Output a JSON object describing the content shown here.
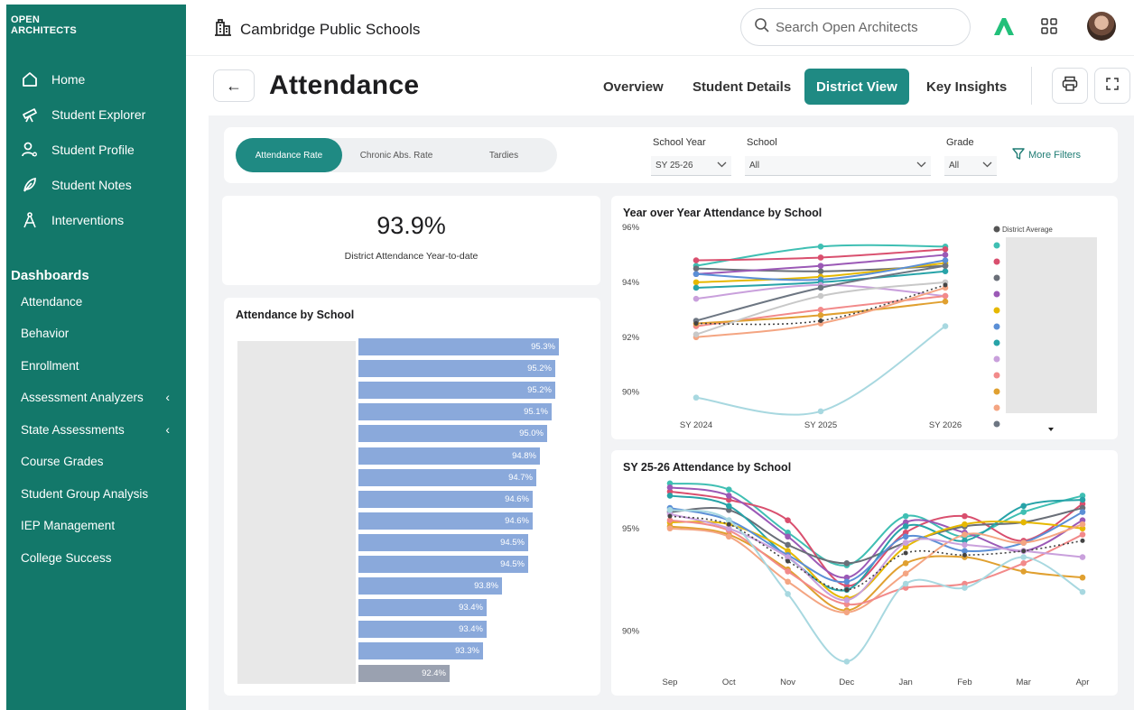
{
  "brand": {
    "line1": "OPEN",
    "line2": "ARCHITECTS"
  },
  "nav": [
    {
      "label": "Home",
      "icon": "home-icon"
    },
    {
      "label": "Student Explorer",
      "icon": "telescope-icon"
    },
    {
      "label": "Student Profile",
      "icon": "profile-icon"
    },
    {
      "label": "Student Notes",
      "icon": "feather-icon"
    },
    {
      "label": "Interventions",
      "icon": "compass-icon"
    }
  ],
  "dashboards": {
    "title": "Dashboards",
    "items": [
      {
        "label": "Attendance",
        "chevron": ""
      },
      {
        "label": "Behavior",
        "chevron": ""
      },
      {
        "label": "Enrollment",
        "chevron": ""
      },
      {
        "label": "Assessment Analyzers",
        "chevron": "‹"
      },
      {
        "label": "State Assessments",
        "chevron": "‹"
      },
      {
        "label": "Course Grades",
        "chevron": ""
      },
      {
        "label": "Student Group Analysis",
        "chevron": ""
      },
      {
        "label": "IEP Management",
        "chevron": ""
      },
      {
        "label": "College Success",
        "chevron": ""
      }
    ]
  },
  "topbar": {
    "org": "Cambridge Public Schools",
    "search_placeholder": "Search Open Architects"
  },
  "header": {
    "title": "Attendance",
    "back": "←",
    "tabs": [
      {
        "label": "Overview",
        "active": false
      },
      {
        "label": "Student Details",
        "active": false
      },
      {
        "label": "District View",
        "active": true
      },
      {
        "label": "Key Insights",
        "active": false
      }
    ]
  },
  "filters": {
    "metrics": [
      "Attendance Rate",
      "Chronic Abs. Rate",
      "Tardies"
    ],
    "school_year": {
      "label": "School Year",
      "value": "SY 25-26"
    },
    "school": {
      "label": "School",
      "value": "All"
    },
    "grade": {
      "label": "Grade",
      "value": "All"
    },
    "more": "More Filters"
  },
  "kpi": {
    "value": "93.9%",
    "label": "District Attendance Year-to-date"
  },
  "colors": {
    "accent": "#1f8a83",
    "sidebar": "#13786a",
    "bar": "#8aa9db",
    "bar_avg": "#9aa1b0"
  },
  "chart_data": [
    {
      "type": "bar",
      "title": "Attendance by School",
      "orientation": "horizontal",
      "values": [
        95.3,
        95.2,
        95.2,
        95.1,
        95.0,
        94.8,
        94.7,
        94.6,
        94.6,
        94.5,
        94.5,
        93.8,
        93.4,
        93.4,
        93.3,
        92.4
      ],
      "labels": [
        "95.3%",
        "95.2%",
        "95.2%",
        "95.1%",
        "95.0%",
        "94.8%",
        "94.7%",
        "94.6%",
        "94.6%",
        "94.5%",
        "94.5%",
        "93.8%",
        "93.4%",
        "93.4%",
        "93.3%",
        "92.4%"
      ],
      "highlight_last": true
    },
    {
      "type": "line",
      "title": "Year over Year Attendance by School",
      "x": [
        "SY 2024",
        "SY 2025",
        "SY 2026"
      ],
      "y_ticks": [
        "96%",
        "94%",
        "92%",
        "90%"
      ],
      "ylim": [
        89.2,
        96
      ],
      "legend_first": "District Average",
      "series": [
        {
          "color": "#3fbfb3",
          "values": [
            94.6,
            95.3,
            95.3
          ]
        },
        {
          "color": "#d94f6e",
          "values": [
            94.8,
            94.9,
            95.2
          ]
        },
        {
          "color": "#6a6f78",
          "values": [
            94.5,
            94.4,
            94.6
          ]
        },
        {
          "color": "#9b59b6",
          "values": [
            94.3,
            94.6,
            95.0
          ]
        },
        {
          "color": "#e6b800",
          "values": [
            94.0,
            94.2,
            94.7
          ]
        },
        {
          "color": "#5b8fd6",
          "values": [
            94.3,
            94.1,
            94.8
          ]
        },
        {
          "color": "#27a3a8",
          "values": [
            93.8,
            94.0,
            94.4
          ]
        },
        {
          "color": "#c9a0dc",
          "values": [
            93.4,
            93.9,
            93.5
          ]
        },
        {
          "color": "#f28a8a",
          "values": [
            92.4,
            93.0,
            93.5
          ]
        },
        {
          "color": "#e0a030",
          "values": [
            92.5,
            92.8,
            93.3
          ]
        },
        {
          "color": "#f4a582",
          "values": [
            92.0,
            92.5,
            93.8
          ]
        },
        {
          "color": "#6d7682",
          "values": [
            92.6,
            93.8,
            94.6
          ]
        },
        {
          "color": "#c8c8c8",
          "values": [
            92.1,
            93.5,
            94.0
          ]
        },
        {
          "color": "#a8d8e0",
          "values": [
            89.8,
            89.3,
            92.4
          ]
        },
        {
          "color": "#444444",
          "values": [
            92.5,
            92.6,
            93.9
          ],
          "dashed": true
        }
      ]
    },
    {
      "type": "line",
      "title": "SY 25-26 Attendance by School",
      "x": [
        "Sep",
        "Oct",
        "Nov",
        "Dec",
        "Jan",
        "Feb",
        "Mar",
        "Apr"
      ],
      "y_ticks": [
        "95%",
        "90%"
      ],
      "ylim": [
        87.5,
        97.5
      ],
      "series": [
        {
          "color": "#3fbfb3",
          "values": [
            97.2,
            96.9,
            94.8,
            93.2,
            95.6,
            94.6,
            95.8,
            96.6
          ]
        },
        {
          "color": "#d94f6e",
          "values": [
            96.8,
            96.4,
            95.4,
            92.2,
            94.8,
            95.6,
            94.4,
            96.2
          ]
        },
        {
          "color": "#9b59b6",
          "values": [
            97.0,
            96.6,
            94.6,
            92.6,
            95.3,
            94.8,
            93.9,
            95.4
          ]
        },
        {
          "color": "#6a6f78",
          "values": [
            95.8,
            95.9,
            94.2,
            93.3,
            94.3,
            95.1,
            95.3,
            96.0
          ]
        },
        {
          "color": "#27a3a8",
          "values": [
            96.6,
            96.1,
            93.6,
            92.0,
            95.1,
            94.4,
            96.1,
            96.4
          ]
        },
        {
          "color": "#e6b800",
          "values": [
            95.3,
            95.2,
            93.9,
            91.6,
            94.1,
            95.2,
            95.3,
            95.0
          ]
        },
        {
          "color": "#5b8fd6",
          "values": [
            96.0,
            95.4,
            93.7,
            92.4,
            94.6,
            93.9,
            94.3,
            95.8
          ]
        },
        {
          "color": "#e0a030",
          "values": [
            95.1,
            94.7,
            93.0,
            91.0,
            93.3,
            93.6,
            92.9,
            92.6
          ]
        },
        {
          "color": "#f4a582",
          "values": [
            95.0,
            94.6,
            92.4,
            90.9,
            92.8,
            94.7,
            94.3,
            95.2
          ]
        },
        {
          "color": "#f28a8a",
          "values": [
            95.4,
            94.9,
            92.9,
            91.3,
            92.1,
            92.3,
            93.3,
            94.7
          ]
        },
        {
          "color": "#c9a0dc",
          "values": [
            95.7,
            95.0,
            93.6,
            91.5,
            94.3,
            94.2,
            93.9,
            93.6
          ]
        },
        {
          "color": "#a8d8e0",
          "values": [
            95.9,
            95.4,
            91.8,
            88.5,
            92.3,
            92.1,
            93.6,
            91.9
          ]
        },
        {
          "color": "#444444",
          "values": [
            95.6,
            95.2,
            93.4,
            92.0,
            93.8,
            93.7,
            93.9,
            94.4
          ],
          "dashed": true
        }
      ]
    }
  ]
}
